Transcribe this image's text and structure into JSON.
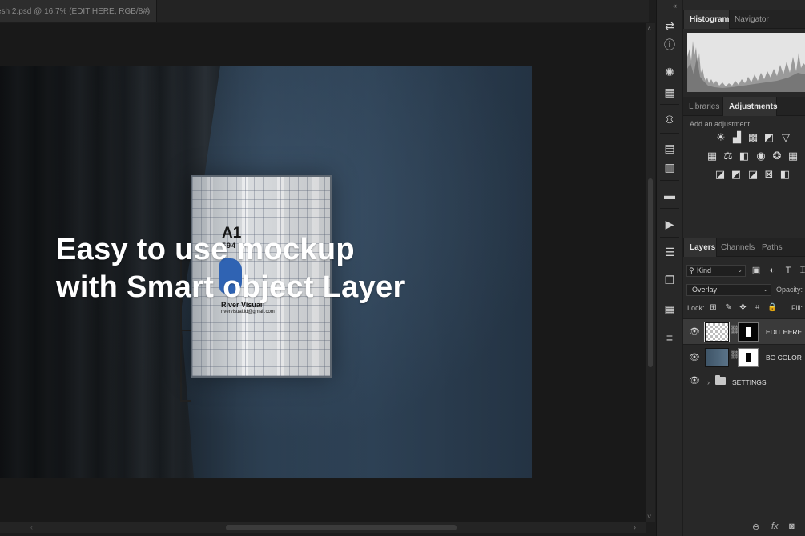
{
  "document": {
    "tab_title": "esh 2.psd @ 16,7% (EDIT HERE, RGB/8#)",
    "close_glyph": "×"
  },
  "artwork": {
    "poster_size": "A1",
    "poster_size_sub": "594",
    "poster_brand": "River Visual",
    "poster_email": "rivervisual.id@gmail.com",
    "overlay_line1": "Easy to use mockup",
    "overlay_line2": "with Smart object Layer"
  },
  "top_panel": {
    "tabs": [
      {
        "label": "Histogram",
        "active": true
      },
      {
        "label": "Navigator",
        "active": false
      }
    ]
  },
  "adjust_panel": {
    "tabs": [
      {
        "label": "Libraries",
        "active": false
      },
      {
        "label": "Adjustments",
        "active": true
      }
    ],
    "title": "Add an adjustment",
    "icons_row1": [
      "brightness-icon",
      "levels-icon",
      "curves-icon",
      "exposure-icon",
      "vibrance-icon"
    ],
    "icons_row2": [
      "hue-saturation-icon",
      "color-balance-icon",
      "black-white-icon",
      "photo-filter-icon",
      "channel-mixer-icon",
      "color-lookup-icon"
    ],
    "icons_row3": [
      "invert-icon",
      "posterize-icon",
      "threshold-icon",
      "gradient-map-icon",
      "selective-color-icon"
    ]
  },
  "layers_panel": {
    "tabs": [
      {
        "label": "Layers",
        "active": true
      },
      {
        "label": "Channels",
        "active": false
      },
      {
        "label": "Paths",
        "active": false
      }
    ],
    "kind_filter": "Kind",
    "blend_mode": "Overlay",
    "opacity_label": "Opacity:",
    "lock_label": "Lock:",
    "fill_label": "Fill:",
    "layers": [
      {
        "name": "EDIT HERE",
        "selected": true
      },
      {
        "name": "BG COLOR",
        "selected": false
      },
      {
        "name": "SETTINGS",
        "selected": false
      }
    ]
  },
  "colors": {
    "panel_bg": "#282828",
    "canvas_bg": "#191919",
    "selected_row": "#3a3a3a",
    "accent_blue": "#2f63b3"
  }
}
